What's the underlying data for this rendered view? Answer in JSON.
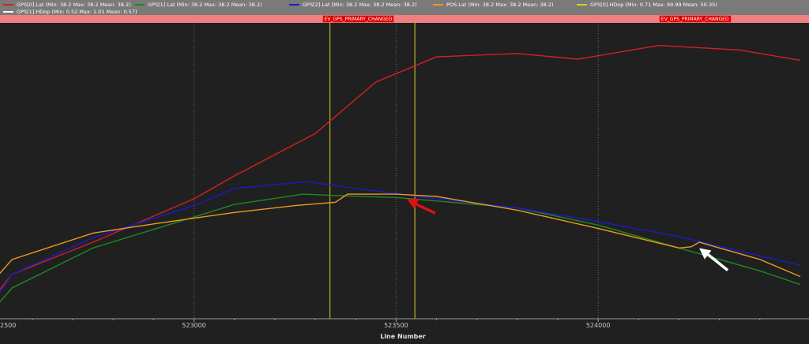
{
  "chart_data": {
    "type": "line",
    "xlabel": "Line Number",
    "ylabel": "",
    "x_ticks": [
      {
        "value": 522500,
        "label": "2500"
      },
      {
        "value": 523000,
        "label": "523000"
      },
      {
        "value": 523500,
        "label": "523500"
      },
      {
        "value": 524000,
        "label": "524000"
      }
    ],
    "xlim": [
      522500,
      524000
    ],
    "grid": "vertical-dashed",
    "legend_position": "top",
    "series": [
      {
        "name": "GPS[0].Lat",
        "legend": "GPS[0].Lat  (Min: 38.2 Max: 38.2 Mean: 38.2)",
        "color": "#d42020",
        "x": [
          522500,
          522550,
          522750,
          523000,
          523100,
          523300,
          523450,
          523600,
          523800,
          523950,
          524150,
          524350,
          524500
        ],
        "y": [
          0.1,
          0.32,
          0.6,
          0.98,
          1.18,
          1.55,
          2.0,
          2.22,
          2.25,
          2.2,
          2.32,
          2.28,
          2.19
        ]
      },
      {
        "name": "GPS[1].Lat",
        "legend": "GPS[1].Lat  (Min: 38.2 Max: 38.2 Mean: 38.2)",
        "color": "#1e8a1e",
        "x": [
          522500,
          522550,
          522750,
          523000,
          523100,
          523270,
          523340,
          523500,
          523800,
          524000,
          524200,
          524400,
          524500
        ],
        "y": [
          0.0,
          0.2,
          0.55,
          0.82,
          0.93,
          1.02,
          1.01,
          0.99,
          0.9,
          0.75,
          0.55,
          0.35,
          0.23
        ]
      },
      {
        "name": "GPS[2].Lat",
        "legend": "GPS[2].Lat  (Min: 38.2 Max: 38.2 Mean: 38.2)",
        "color": "#1a1acc",
        "x": [
          522500,
          522550,
          522750,
          523000,
          523100,
          523280,
          523380,
          523600,
          523800,
          524000,
          524200,
          524400,
          524500
        ],
        "y": [
          0.05,
          0.32,
          0.64,
          0.92,
          1.07,
          1.13,
          1.08,
          0.98,
          0.9,
          0.78,
          0.65,
          0.48,
          0.4
        ]
      },
      {
        "name": "POS.Lat",
        "legend": "POS.Lat  (Min: 38.2 Max: 38.2 Mean: 38.2)",
        "color": "#e89a20",
        "x": [
          522500,
          522550,
          522750,
          522900,
          523100,
          523250,
          523350,
          523380,
          523500,
          523600,
          523800,
          524000,
          524200,
          524230,
          524250,
          524400,
          524500
        ],
        "y": [
          0.25,
          0.45,
          0.68,
          0.76,
          0.86,
          0.92,
          0.95,
          1.02,
          1.02,
          1.0,
          0.88,
          0.72,
          0.55,
          0.56,
          0.6,
          0.45,
          0.3
        ]
      },
      {
        "name": "GPS[0].HDop",
        "legend": "GPS[0].HDop  (Min: 0.71 Max: 99.99 Mean: 50.35)",
        "color": "#d8d020",
        "x": [],
        "y": []
      },
      {
        "name": "GPS[1].HDop",
        "legend": "GPS[1].HDop  (Min: 0.52 Max: 1.01 Mean: 0.57)",
        "color": "#ffffff",
        "x": [],
        "y": []
      }
    ],
    "events": [
      {
        "label": "EV_GPS_PRIMARY_CHANGED",
        "x": 523180
      },
      {
        "label": "EV_GPS_PRIMARY_CHANGED",
        "x": 524150
      }
    ],
    "markers": [
      {
        "x": 523180,
        "color": "#d8d020"
      },
      {
        "x": 523390,
        "color": "#d8d020"
      }
    ],
    "annotations": [
      {
        "type": "arrow",
        "color": "#e01010",
        "target_x": 523370,
        "target_y": 1.02
      },
      {
        "type": "arrow",
        "color": "#ffffff",
        "target_x": 524250,
        "target_y": 0.59
      }
    ]
  }
}
